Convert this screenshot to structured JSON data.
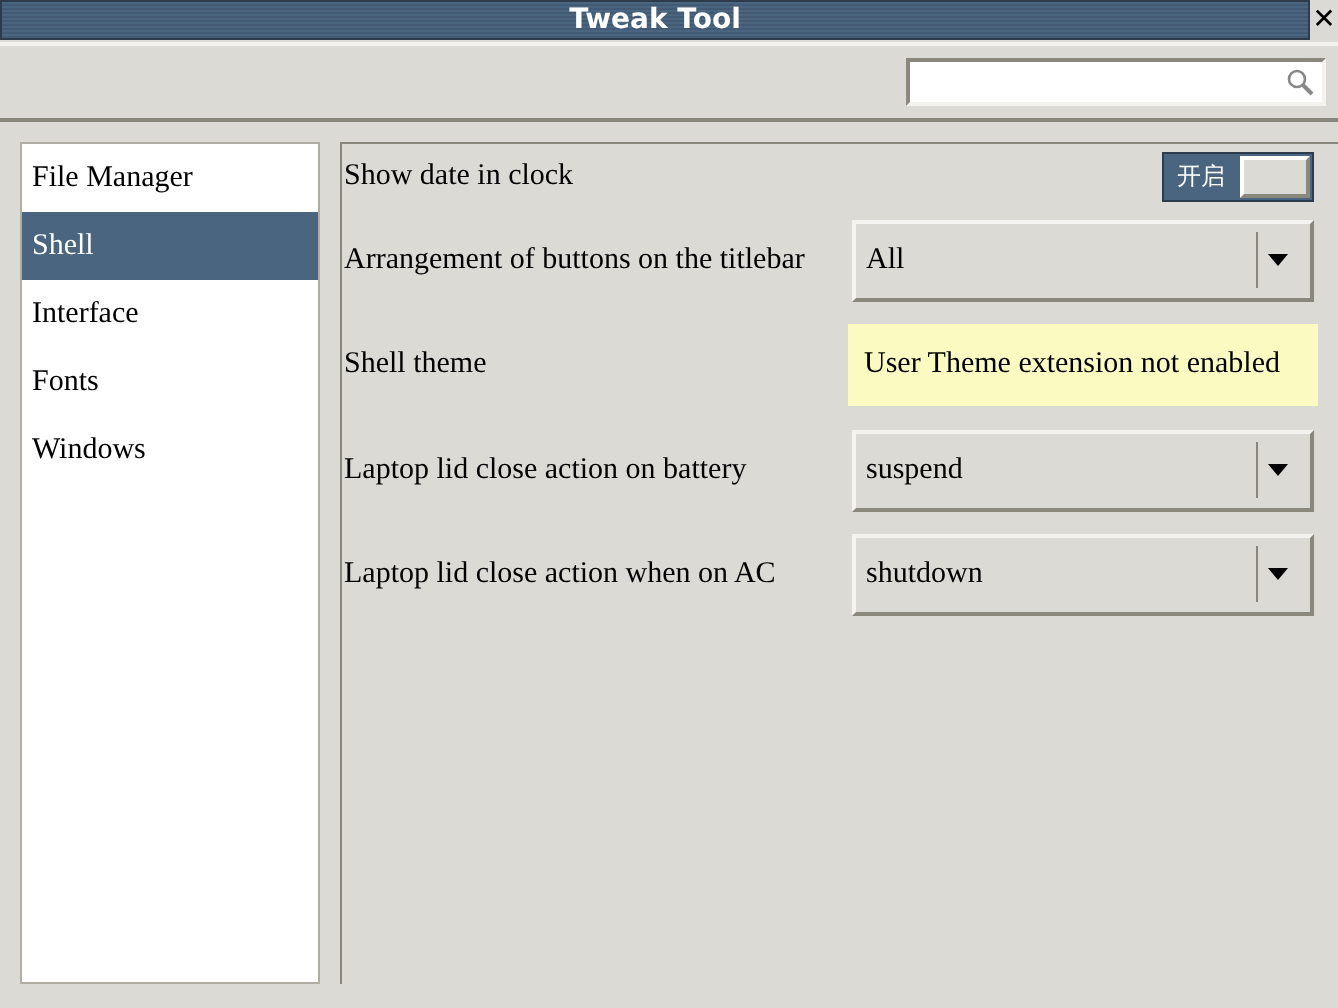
{
  "window": {
    "title": "Tweak Tool",
    "close": "✕"
  },
  "sidebar": {
    "items": [
      {
        "label": "File Manager",
        "selected": false
      },
      {
        "label": "Shell",
        "selected": true
      },
      {
        "label": "Interface",
        "selected": false
      },
      {
        "label": "Fonts",
        "selected": false
      },
      {
        "label": "Windows",
        "selected": false
      }
    ]
  },
  "settings": [
    {
      "kind": "switch",
      "label": "Show date in clock",
      "on": true,
      "switch_label": "开启"
    },
    {
      "kind": "combo",
      "label": "Arrangement of buttons on the titlebar",
      "value": "All"
    },
    {
      "kind": "info",
      "label": "Shell theme",
      "message": "User Theme extension not enabled"
    },
    {
      "kind": "combo",
      "label": "Laptop lid close action on battery",
      "value": "suspend"
    },
    {
      "kind": "combo",
      "label": "Laptop lid close action when on AC",
      "value": "shutdown"
    }
  ]
}
